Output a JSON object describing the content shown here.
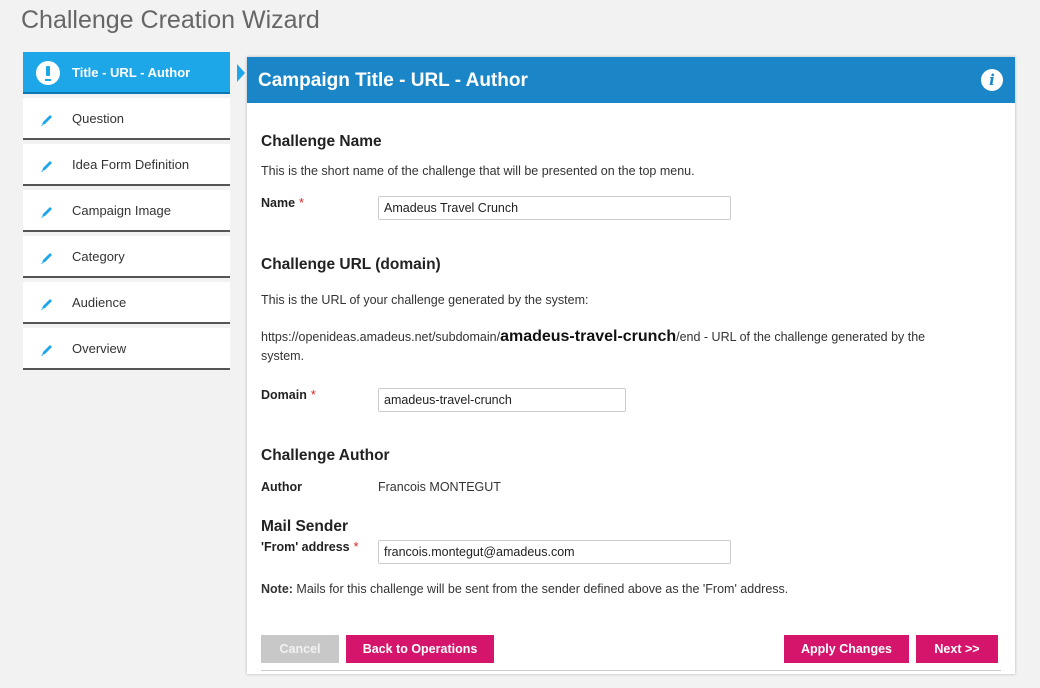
{
  "page_title": "Challenge Creation Wizard",
  "sidebar": {
    "steps": [
      {
        "label": "Title - URL - Author",
        "icon": "exclamation-circle-icon",
        "active": true
      },
      {
        "label": "Question",
        "icon": "pencil-icon"
      },
      {
        "label": "Idea Form Definition",
        "icon": "pencil-icon"
      },
      {
        "label": "Campaign Image",
        "icon": "pencil-icon"
      },
      {
        "label": "Category",
        "icon": "pencil-icon"
      },
      {
        "label": "Audience",
        "icon": "pencil-icon"
      },
      {
        "label": "Overview",
        "icon": "pencil-icon"
      }
    ]
  },
  "panel": {
    "title": "Campaign Title - URL - Author",
    "info_icon": "i",
    "challenge_name": {
      "heading": "Challenge Name",
      "description": "This is the short name of the challenge that will be presented on the top menu.",
      "name_label": "Name",
      "required_mark": "*",
      "name_value": "Amadeus Travel Crunch"
    },
    "challenge_url": {
      "heading": "Challenge URL (domain)",
      "description": "This is the URL of your challenge generated by the system:",
      "url_prefix": "https://openideas.amadeus.net/subdomain/",
      "url_domain": "amadeus-travel-crunch",
      "url_suffix": "/end - URL of the challenge generated by the system.",
      "domain_label": "Domain",
      "required_mark": "*",
      "domain_value": "amadeus-travel-crunch"
    },
    "challenge_author": {
      "heading": "Challenge Author",
      "author_label": "Author",
      "author_value": "Francois MONTEGUT"
    },
    "mail_sender": {
      "heading": "Mail Sender",
      "from_label": "'From' address",
      "required_mark": "*",
      "from_value": "francois.montegut@amadeus.com",
      "note_bold": "Note:",
      "note_text": " Mails for this challenge will be sent from the sender defined above as the 'From' address."
    },
    "buttons": {
      "cancel": "Cancel",
      "back": "Back to Operations",
      "apply": "Apply Changes",
      "next": "Next >>"
    }
  },
  "colors": {
    "accent_blue": "#1da6e8",
    "header_blue": "#1a86c8",
    "button_pink": "#d4156b",
    "disabled_gray": "#c8c8c8",
    "required_red": "#d9241f"
  }
}
